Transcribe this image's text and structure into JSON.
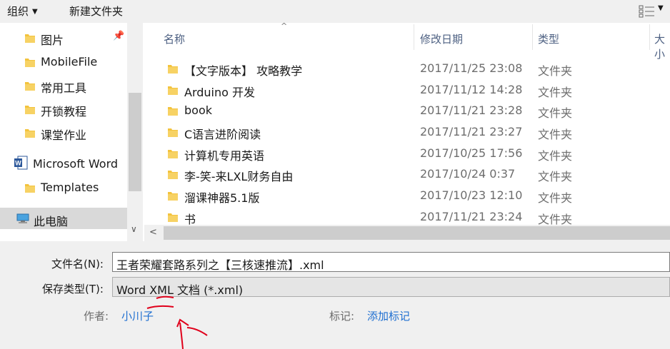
{
  "toolbar": {
    "organize_label": "组织",
    "new_folder_label": "新建文件夹"
  },
  "nav": {
    "items": [
      {
        "label": "图片",
        "pinned": true
      },
      {
        "label": "MobileFile"
      },
      {
        "label": "常用工具"
      },
      {
        "label": "开锁教程"
      },
      {
        "label": "课堂作业"
      },
      {
        "label": "Microsoft Word"
      },
      {
        "label": "Templates"
      },
      {
        "label": "此电脑",
        "selected": true
      }
    ]
  },
  "columns": {
    "name": "名称",
    "date": "修改日期",
    "type": "类型",
    "size": "大小"
  },
  "files": [
    {
      "name": "【文字版本】 攻略教学",
      "date": "2017/11/25 23:08",
      "type": "文件夹"
    },
    {
      "name": "Arduino 开发",
      "date": "2017/11/12 14:28",
      "type": "文件夹"
    },
    {
      "name": "book",
      "date": "2017/11/21 23:28",
      "type": "文件夹"
    },
    {
      "name": "C语言进阶阅读",
      "date": "2017/11/21 23:27",
      "type": "文件夹"
    },
    {
      "name": "计算机专用英语",
      "date": "2017/10/25 17:56",
      "type": "文件夹"
    },
    {
      "name": "李-笑-来LXL财务自由",
      "date": "2017/10/24 0:37",
      "type": "文件夹"
    },
    {
      "name": "溜课神器5.1版",
      "date": "2017/10/23 12:10",
      "type": "文件夹"
    },
    {
      "name": "书",
      "date": "2017/11/21 23:24",
      "type": "文件夹"
    }
  ],
  "form": {
    "filename_label": "文件名(N):",
    "filename_value": "王者荣耀套路系列之【三核速推流】.xml",
    "filetype_label": "保存类型(T):",
    "filetype_value": "Word XML 文档 (*.xml)",
    "author_label": "作者:",
    "author_value": "小川子",
    "tags_label": "标记:",
    "tags_value": "添加标记"
  },
  "colors": {
    "folder": "#f3c33d",
    "link": "#1f6fd1",
    "annotation": "#e0001b"
  }
}
